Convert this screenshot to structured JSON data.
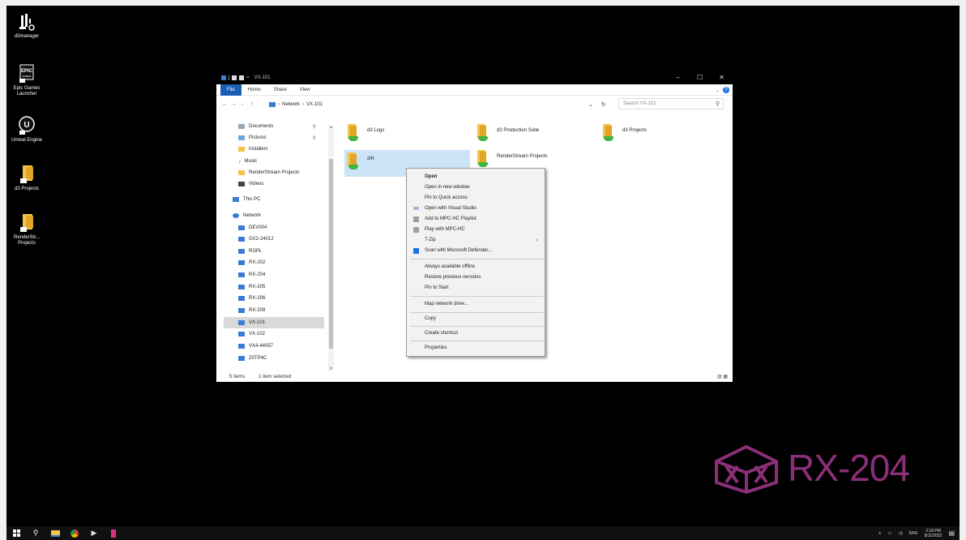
{
  "desktop_icons": [
    {
      "label": "d3manager",
      "icon": "d3manager-icon"
    },
    {
      "label": "Epic Games Launcher",
      "icon": "epic-games-icon"
    },
    {
      "label": "Unreal Engine",
      "icon": "unreal-engine-icon"
    },
    {
      "label": "d3 Projects",
      "icon": "folder-shortcut-icon"
    },
    {
      "label": "RenderStr... Projects",
      "icon": "folder-shortcut-icon"
    }
  ],
  "explorer": {
    "title": "VX-101",
    "window_controls": {
      "minimize": "–",
      "maximize": "☐",
      "close": "✕"
    },
    "ribbon_tabs": [
      "File",
      "Home",
      "Share",
      "View"
    ],
    "address": {
      "root": "Network",
      "current": "VX-101"
    },
    "search_placeholder": "Search VX-101",
    "nav_items": [
      {
        "label": "Documents",
        "pinned": true,
        "icon": "documents-icon"
      },
      {
        "label": "Pictures",
        "pinned": true,
        "icon": "pictures-icon"
      },
      {
        "label": "installers",
        "pinned": false,
        "icon": "folder-icon"
      },
      {
        "label": "Music",
        "pinned": false,
        "icon": "music-icon"
      },
      {
        "label": "RenderStream Projects",
        "pinned": false,
        "icon": "folder-icon"
      },
      {
        "label": "Videos",
        "pinned": false,
        "icon": "videos-icon"
      },
      {
        "label": "This PC",
        "pinned": false,
        "icon": "this-pc-icon"
      },
      {
        "label": "Network",
        "pinned": false,
        "icon": "network-icon"
      },
      {
        "label": "DEV004",
        "pinned": false,
        "icon": "computer-icon"
      },
      {
        "label": "GX2-24012",
        "pinned": false,
        "icon": "computer-icon"
      },
      {
        "label": "ROPL",
        "pinned": false,
        "icon": "computer-icon"
      },
      {
        "label": "RX-202",
        "pinned": false,
        "icon": "computer-icon"
      },
      {
        "label": "RX-204",
        "pinned": false,
        "icon": "computer-icon"
      },
      {
        "label": "RX-205",
        "pinned": false,
        "icon": "computer-icon"
      },
      {
        "label": "RX-206",
        "pinned": false,
        "icon": "computer-icon"
      },
      {
        "label": "RX-209",
        "pinned": false,
        "icon": "computer-icon"
      },
      {
        "label": "VX-101",
        "pinned": false,
        "icon": "computer-icon",
        "selected": true
      },
      {
        "label": "VX-102",
        "pinned": false,
        "icon": "computer-icon"
      },
      {
        "label": "VX4-44057",
        "pinned": false,
        "icon": "computer-icon"
      },
      {
        "label": "Z0TP4C",
        "pinned": false,
        "icon": "computer-icon"
      }
    ],
    "folders": [
      {
        "name": "d3 Logs"
      },
      {
        "name": "d3 Production Suite"
      },
      {
        "name": "d3 Projects"
      },
      {
        "name": "d4t",
        "selected": true
      },
      {
        "name": "RenderStream Projects"
      }
    ],
    "status": {
      "items": "5 items",
      "selected": "1 item selected"
    }
  },
  "context_menu": {
    "items": [
      {
        "label": "Open",
        "bold": true
      },
      {
        "label": "Open in new window"
      },
      {
        "label": "Pin to Quick access"
      },
      {
        "label": "Open with Visual Studio",
        "icon": "visual-studio-icon"
      },
      {
        "label": "Add to MPC-HC Playlist",
        "icon": "mpc-hc-icon"
      },
      {
        "label": "Play with MPC-HC",
        "icon": "mpc-hc-icon"
      },
      {
        "label": "7-Zip",
        "submenu": true
      },
      {
        "label": "Scan with Microsoft Defender...",
        "icon": "defender-icon"
      },
      {
        "label": "Always available offline"
      },
      {
        "label": "Restore previous versions"
      },
      {
        "label": "Pin to Start"
      },
      {
        "label": "Map network drive..."
      },
      {
        "label": "Copy"
      },
      {
        "label": "Create shortcut"
      },
      {
        "label": "Properties"
      }
    ]
  },
  "watermark": {
    "text": "RX-204",
    "color": "#8b2f78"
  },
  "taskbar": {
    "apps": [
      "windows-start-icon",
      "search-icon",
      "file-explorer-icon",
      "chrome-icon",
      "terminal-icon",
      "app-icon"
    ],
    "tray": {
      "lang": "ENG",
      "time": "2:18 PM",
      "date": "8/11/2022"
    }
  }
}
